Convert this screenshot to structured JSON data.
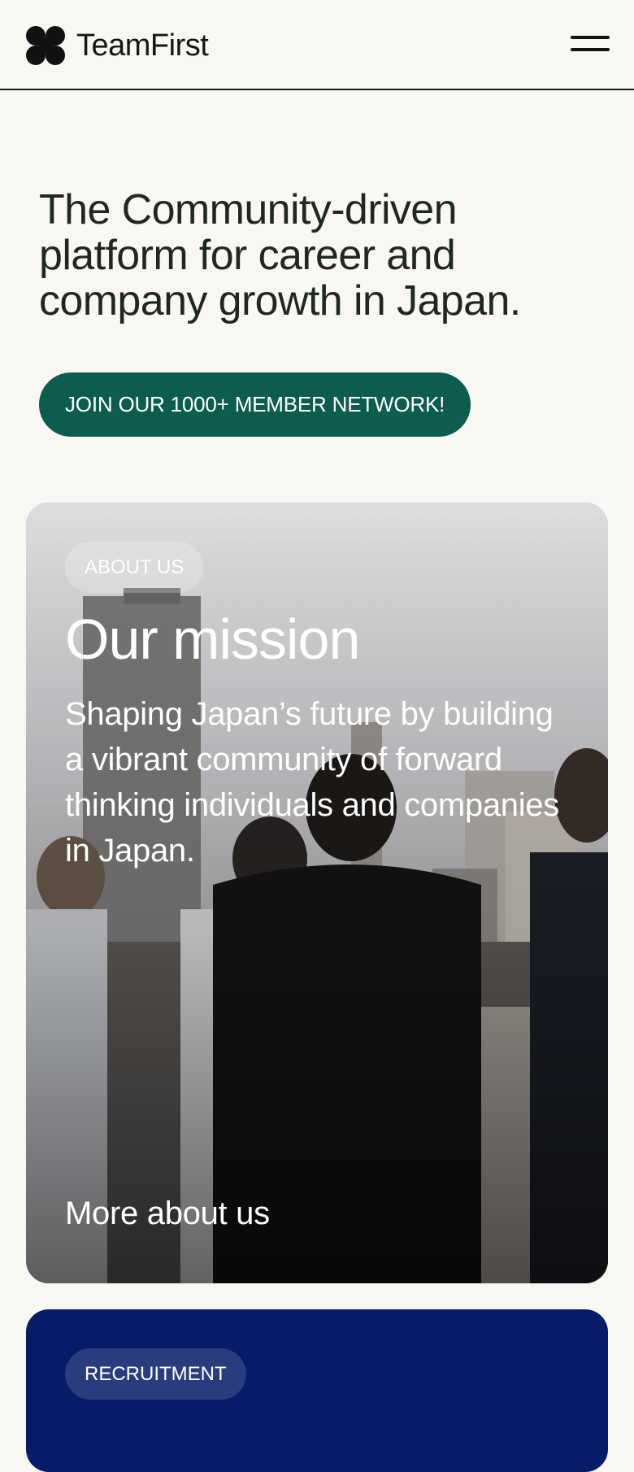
{
  "header": {
    "brand": "TeamFirst",
    "logo_icon": "four-petal-clover-logo",
    "menu_icon": "hamburger-menu-icon"
  },
  "hero": {
    "title": "The Community-driven platform for career and company growth in Japan.",
    "cta_label": "JOIN OUR 1000+ MEMBER NETWORK!"
  },
  "mission_card": {
    "tag": "ABOUT US",
    "title": "Our mission",
    "body": "Shaping Japan’s future by building a vibrant community of forward thinking individuals and companies in Japan.",
    "link_label": "More about us"
  },
  "recruitment_card": {
    "tag": "RECRUITMENT"
  },
  "colors": {
    "background": "#f8f7f1",
    "primary_green": "#0d5d4e",
    "navy": "#061c69",
    "text_dark": "#1f2724"
  }
}
